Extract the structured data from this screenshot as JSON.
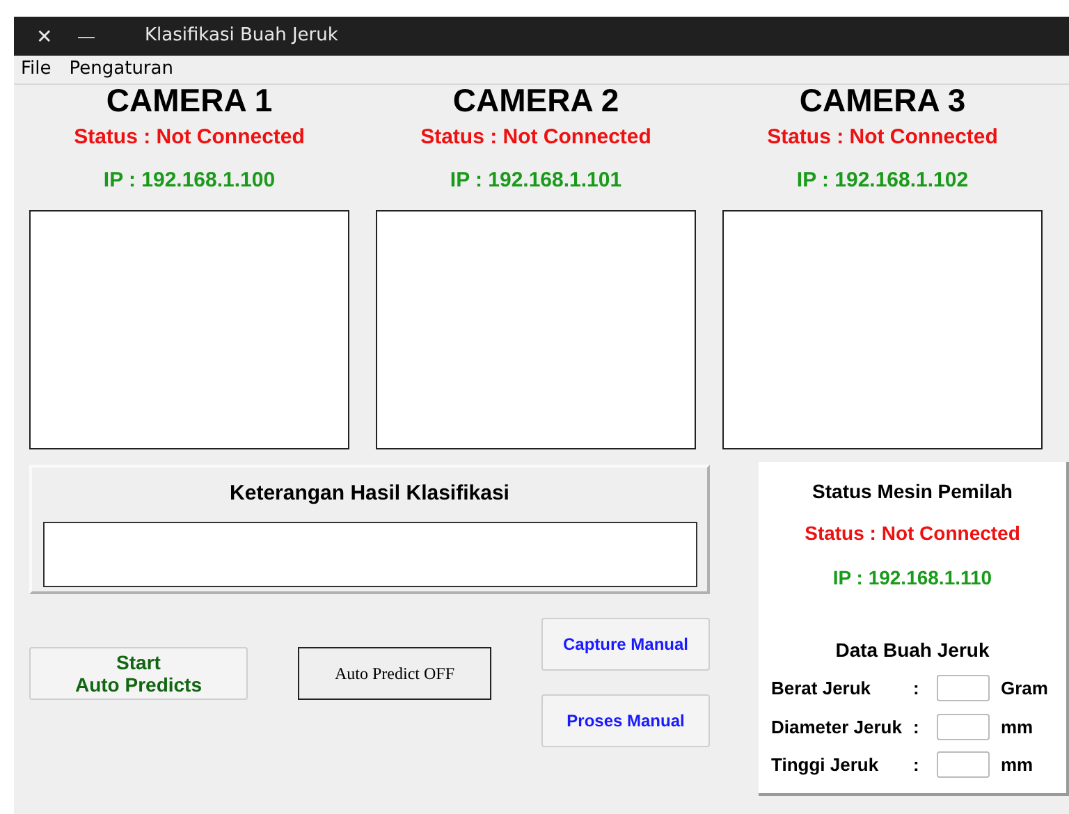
{
  "window": {
    "title": "Klasifikasi Buah Jeruk",
    "close_glyph": "✕",
    "minimize_glyph": "—"
  },
  "menu": [
    "File",
    "Pengaturan"
  ],
  "cameras": [
    {
      "title": "CAMERA 1",
      "status": "Status : Not Connected",
      "ip": "IP : 192.168.1.100"
    },
    {
      "title": "CAMERA 2",
      "status": "Status : Not Connected",
      "ip": "IP : 192.168.1.101"
    },
    {
      "title": "CAMERA 3",
      "status": "Status : Not Connected",
      "ip": "IP : 192.168.1.102"
    }
  ],
  "result_panel": {
    "title": "Keterangan Hasil Klasifikasi"
  },
  "controls": {
    "start_button": "Start\nAuto Predicts",
    "auto_predict_indicator": "Auto Predict OFF",
    "capture_button": "Capture Manual",
    "process_button": "Proses Manual"
  },
  "machine_panel": {
    "title": "Status Mesin Pemilah",
    "status": "Status : Not Connected",
    "ip": "IP : 192.168.1.110",
    "data_title": "Data Buah Jeruk",
    "fields": [
      {
        "label": "Berat Jeruk",
        "separator": ":",
        "unit": "Gram"
      },
      {
        "label": "Diameter Jeruk",
        "separator": ":",
        "unit": "mm"
      },
      {
        "label": "Tinggi Jeruk",
        "separator": ":",
        "unit": "mm"
      }
    ]
  }
}
